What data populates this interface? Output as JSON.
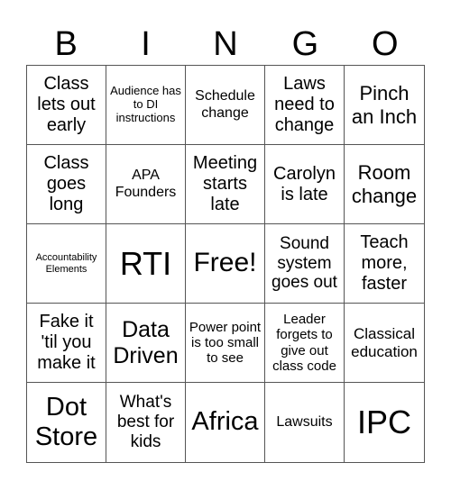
{
  "header": {
    "letters": [
      "B",
      "I",
      "N",
      "G",
      "O"
    ]
  },
  "cells": [
    "Class lets out early",
    "Audience has to DI instructions",
    "Schedule change",
    "Laws need to change",
    "Pinch an Inch",
    "Class goes long",
    "APA Founders",
    "Meeting starts late",
    "Carolyn is late",
    "Room change",
    "Accountability Elements",
    "RTI",
    "Free!",
    "Sound system goes out",
    "Teach more, faster",
    "Fake it 'til you make it",
    "Data Driven",
    "Power point is too small to see",
    "Leader forgets to give out class code",
    "Classical education",
    "Dot Store",
    "What's best for kids",
    "Africa",
    "Lawsuits",
    "IPC"
  ]
}
